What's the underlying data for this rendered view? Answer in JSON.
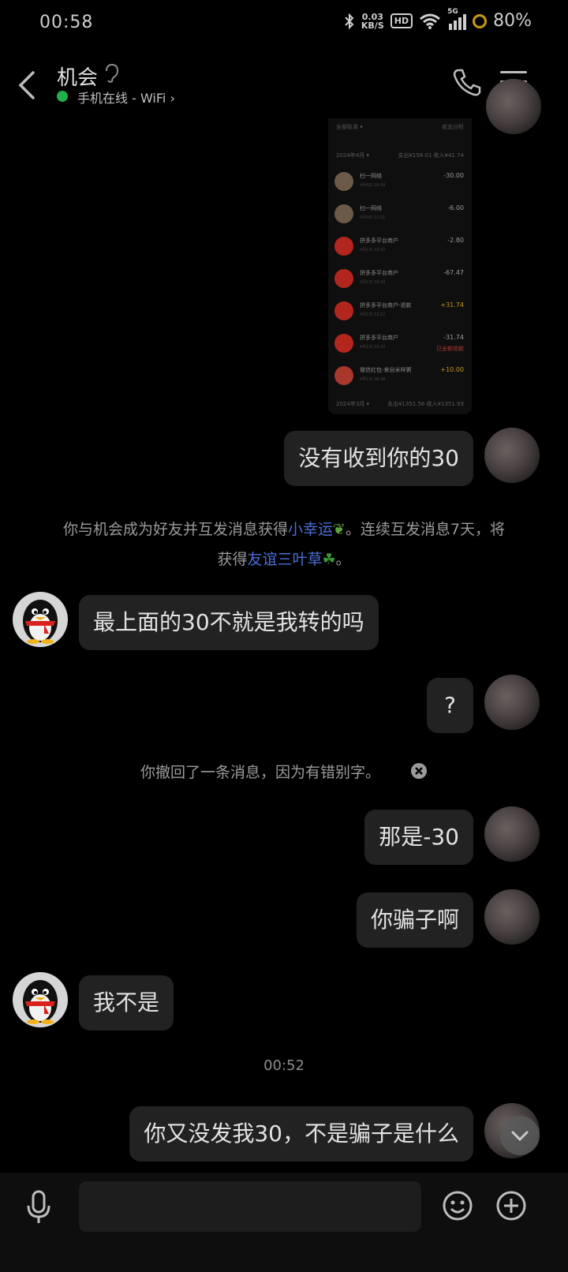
{
  "status_bar": {
    "time": "00:58",
    "net_speed_value": "0.03",
    "net_speed_unit": "KB/S",
    "hd": "HD",
    "network": "5G",
    "battery": "80%"
  },
  "header": {
    "contact_name": "机会",
    "presence": "手机在线 - WiFi",
    "presence_chevron": "›",
    "back_icon": "chevron-left-icon",
    "call_icon": "phone-icon",
    "menu_icon": "hamburger-icon"
  },
  "shared_screenshot": {
    "filter": "全部账单 ▾",
    "stats": "收支分析",
    "month_label": "2024年4月 ▾",
    "month_summary": "支出¥158.01  收入¥41.74",
    "rows": [
      {
        "title": "扫一网络",
        "sub": "4月4日 16:44",
        "amount": "-30.00",
        "note": "",
        "kind": "person"
      },
      {
        "title": "扫一网络",
        "sub": "4月4日 12:11",
        "amount": "-6.00",
        "note": "",
        "kind": "person"
      },
      {
        "title": "拼多多平台商户",
        "sub": "4月1日 18:52",
        "amount": "-2.80",
        "note": "",
        "kind": "pdd"
      },
      {
        "title": "拼多多平台商户",
        "sub": "4月1日 18:18",
        "amount": "-67.47",
        "note": "",
        "kind": "pdd"
      },
      {
        "title": "拼多多平台商户-退款",
        "sub": "4月1日 13:12",
        "amount": "+31.74",
        "note": "",
        "kind": "pdd"
      },
      {
        "title": "拼多多平台商户",
        "sub": "4月1日 10:10",
        "amount": "-31.74",
        "note": "已全额退款",
        "kind": "pdd"
      },
      {
        "title": "微信红包-来自米样粥",
        "sub": "4月1日 06:28",
        "amount": "+10.00",
        "note": "",
        "kind": "hongbao"
      }
    ],
    "footer_month": "2024年3月 ▾",
    "footer_summary": "支出¥1351.56  收入¥1351.93"
  },
  "messages": {
    "m1": "没有收到你的30",
    "sys_friend_part1": "你与机会成为好友并互发消息获得",
    "sys_friend_hl1": "小幸运",
    "sys_friend_part2": "。连续互发消息7天，将",
    "sys_friend_part3": "获得",
    "sys_friend_hl2": "友谊三叶草",
    "sys_friend_part4": "。",
    "m2": "最上面的30不就是我转的吗",
    "m3": "?",
    "sys_recall": "你撤回了一条消息，因为有错别字。",
    "m4": "那是-30",
    "m5": "你骗子啊",
    "m6": "我不是",
    "time_sep": "00:52",
    "m7": "你又没发我30，不是骗子是什么"
  },
  "input_bar": {
    "mic_icon": "microphone-icon",
    "emoji_icon": "smiley-icon",
    "plus_icon": "plus-circle-icon"
  },
  "colors": {
    "background": "#000000",
    "bubble": "#222222",
    "link": "#4a6fd6",
    "online": "#20b04b"
  }
}
